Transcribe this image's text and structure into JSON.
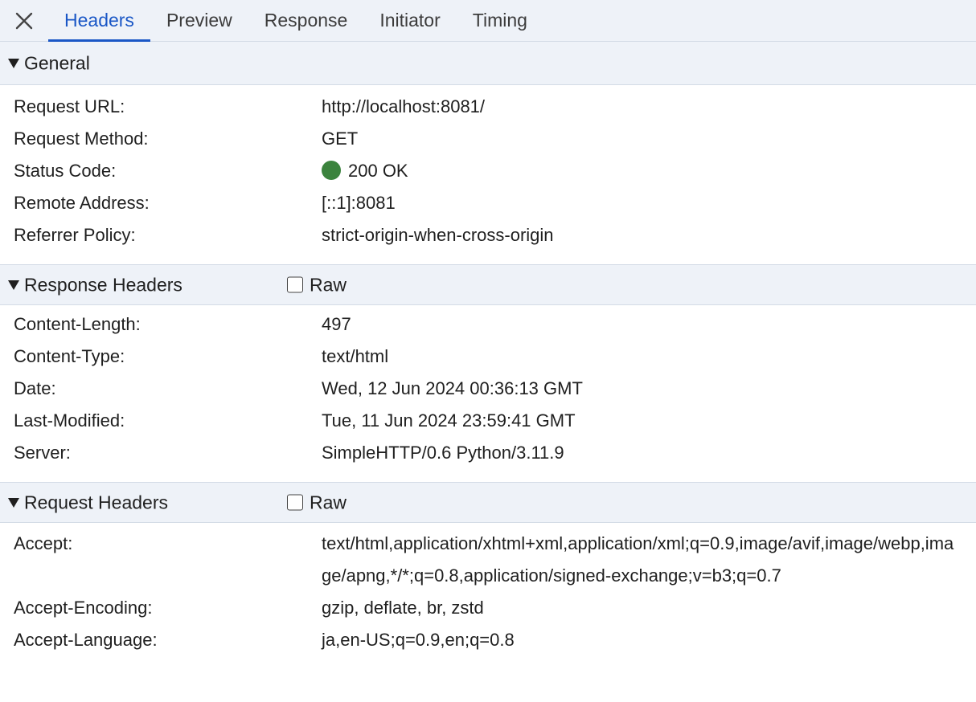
{
  "tabs": [
    {
      "label": "Headers",
      "active": true
    },
    {
      "label": "Preview",
      "active": false
    },
    {
      "label": "Response",
      "active": false
    },
    {
      "label": "Initiator",
      "active": false
    },
    {
      "label": "Timing",
      "active": false
    }
  ],
  "general": {
    "title": "General",
    "rows": [
      {
        "key": "Request URL:",
        "value": "http://localhost:8081/"
      },
      {
        "key": "Request Method:",
        "value": "GET"
      },
      {
        "key": "Status Code:",
        "value": "200 OK"
      },
      {
        "key": "Remote Address:",
        "value": "[::1]:8081"
      },
      {
        "key": "Referrer Policy:",
        "value": "strict-origin-when-cross-origin"
      }
    ]
  },
  "response_headers": {
    "title": "Response Headers",
    "raw_label": "Raw",
    "raw_checked": false,
    "rows": [
      {
        "key": "Content-Length:",
        "value": "497"
      },
      {
        "key": "Content-Type:",
        "value": "text/html"
      },
      {
        "key": "Date:",
        "value": "Wed, 12 Jun 2024 00:36:13 GMT"
      },
      {
        "key": "Last-Modified:",
        "value": "Tue, 11 Jun 2024 23:59:41 GMT"
      },
      {
        "key": "Server:",
        "value": "SimpleHTTP/0.6 Python/3.11.9"
      }
    ]
  },
  "request_headers": {
    "title": "Request Headers",
    "raw_label": "Raw",
    "raw_checked": false,
    "rows": [
      {
        "key": "Accept:",
        "value": "text/html,application/xhtml+xml,application/xml;q=0.9,image/avif,image/webp,image/apng,*/*;q=0.8,application/signed-exchange;v=b3;q=0.7"
      },
      {
        "key": "Accept-Encoding:",
        "value": "gzip, deflate, br, zstd"
      },
      {
        "key": "Accept-Language:",
        "value": "ja,en-US;q=0.9,en;q=0.8"
      }
    ]
  },
  "colors": {
    "accent": "#1a57c6",
    "status_ok": "#3b833d",
    "header_bg": "#eef2f8"
  }
}
